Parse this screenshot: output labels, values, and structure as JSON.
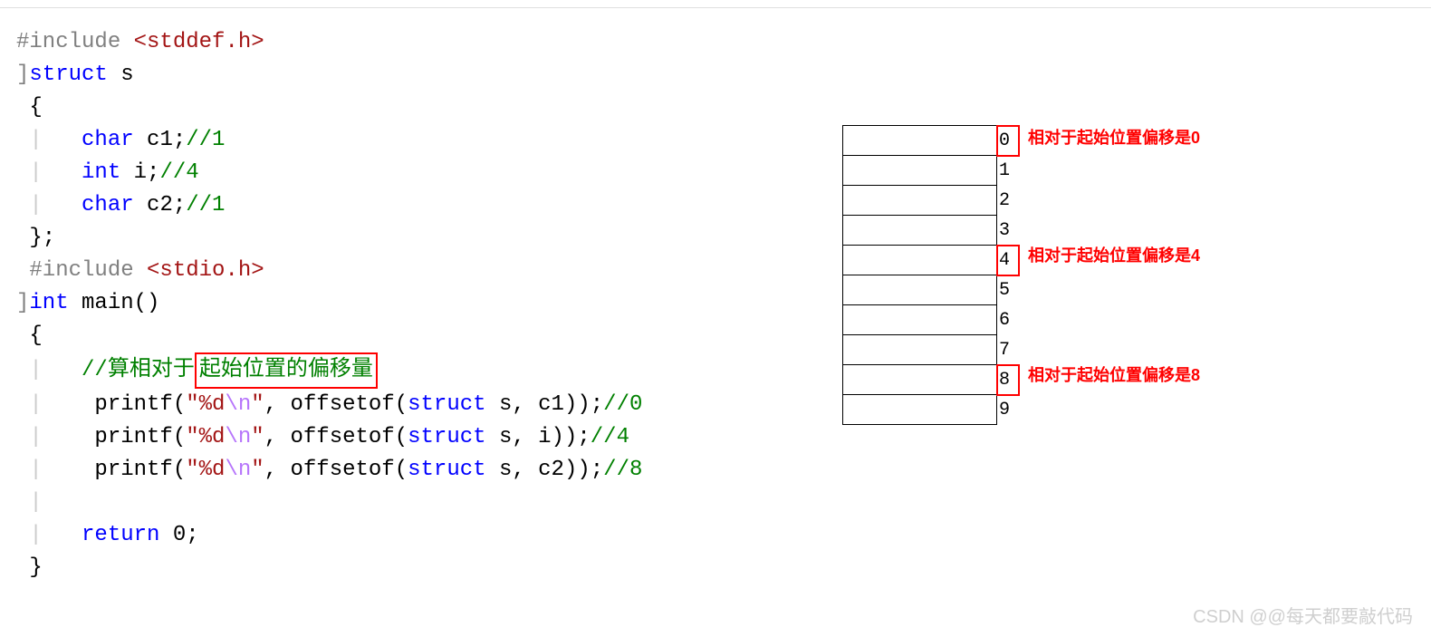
{
  "code": {
    "include1_pp": "#include ",
    "include1_hdr": "<stddef.h>",
    "struct_kw": "struct",
    "struct_name": " s",
    "obrace": "{",
    "field1_kw": "char",
    "field1_rest": " c1;",
    "field1_cmt": "//1",
    "field2_kw": "int",
    "field2_rest": " i;",
    "field2_cmt": "//4",
    "field3_kw": "char",
    "field3_rest": " c2;",
    "field3_cmt": "//1",
    "cstruct": "};",
    "include2_pp": "#include ",
    "include2_hdr": "<stdio.h>",
    "main_kw": "int",
    "main_rest": " main()",
    "obrace2": "{",
    "cmt_offset_pre": "//算相对于",
    "cmt_offset_box": "起始位置的偏移量",
    "printf1_a": "    printf(",
    "printf_fmt_open": "\"%d",
    "printf_fmt_esc": "\\n",
    "printf_fmt_close": "\"",
    "printf1_b": ", offsetof(",
    "printf1_kw": "struct",
    "printf1_c": " s, c1));",
    "printf1_cmt": "//0",
    "printf2_b": ", offsetof(",
    "printf2_kw": "struct",
    "printf2_c": " s, i));",
    "printf2_cmt": "//4",
    "printf3_b": ", offsetof(",
    "printf3_kw": "struct",
    "printf3_c": " s, c2));",
    "printf3_cmt": "//8",
    "return_kw": "return",
    "return_rest": " 0;",
    "cbrace": "}"
  },
  "memory": {
    "labels": [
      "0",
      "1",
      "2",
      "3",
      "4",
      "5",
      "6",
      "7",
      "8",
      "9"
    ],
    "annot0": "相对于起始位置偏移是0",
    "annot4": "相对于起始位置偏移是4",
    "annot8": "相对于起始位置偏移是8"
  },
  "watermark": "CSDN @@每天都要敲代码"
}
